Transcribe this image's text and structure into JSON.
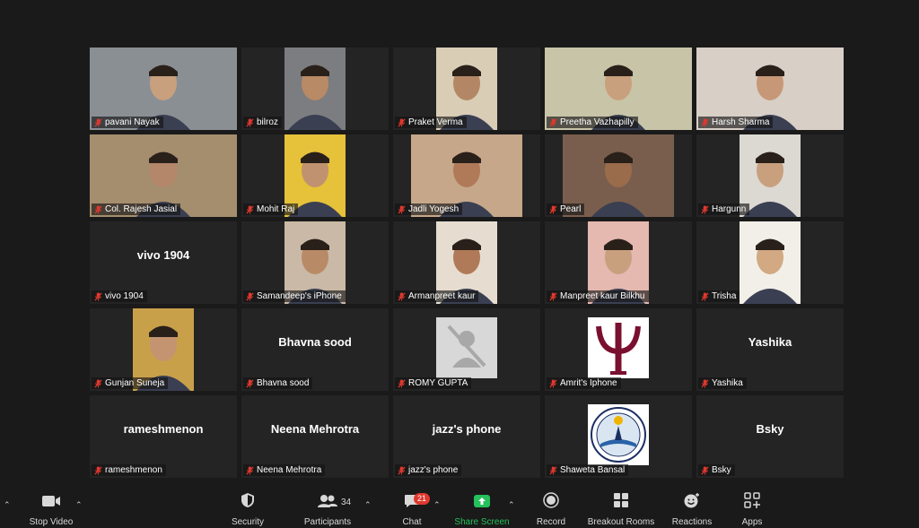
{
  "participants": [
    {
      "name": "pavani Nayak",
      "video": true,
      "bg": "#8a8f94",
      "face": "#c9a07d"
    },
    {
      "name": "bilroz",
      "video": true,
      "bg": "#7b7d80",
      "face": "#b98a66"
    },
    {
      "name": "Praket Verma",
      "video": true,
      "bg": "#d9cdb6",
      "face": "#b38765"
    },
    {
      "name": "Preetha Vazhapilly",
      "video": true,
      "bg": "#c8c4a8",
      "face": "#c9a07d"
    },
    {
      "name": "Harsh Sharma",
      "video": true,
      "bg": "#d8cfc6",
      "face": "#c79878"
    },
    {
      "name": "Col. Rajesh Jasial",
      "video": true,
      "bg": "#a58e6e",
      "face": "#b4866a"
    },
    {
      "name": "Mohit Raj",
      "video": true,
      "bg": "#e6c13a",
      "face": "#c09270"
    },
    {
      "name": "Jadli Yogesh",
      "video": true,
      "bg": "#c6a78a",
      "face": "#b07a58"
    },
    {
      "name": "Pearl",
      "video": true,
      "bg": "#7a5e4d",
      "face": "#9a6c4c"
    },
    {
      "name": "Hargunn",
      "video": true,
      "bg": "#dcd8d2",
      "face": "#c9a07d"
    },
    {
      "name": "vivo 1904",
      "video": false
    },
    {
      "name": "Samandeep's iPhone",
      "video": true,
      "bg": "#c9b9a6",
      "face": "#b98a66"
    },
    {
      "name": "Armanpreet kaur",
      "video": true,
      "bg": "#e6ddd0",
      "face": "#b07a58"
    },
    {
      "name": "Manpreet kaur Bilkhu",
      "video": true,
      "bg": "#e5b8b0",
      "face": "#c9a07d"
    },
    {
      "name": "Trisha",
      "video": true,
      "bg": "#f2efe8",
      "face": "#d2a982"
    },
    {
      "name": "Gunjan Suneja",
      "video": true,
      "bg": "#c9a04a",
      "face": "#c49370"
    },
    {
      "name": "Bhavna sood",
      "video": false
    },
    {
      "name": "ROMY GUPTA",
      "video": false,
      "placeholder": true
    },
    {
      "name": "Amrit's Iphone",
      "video": false,
      "psi": true
    },
    {
      "name": "Yashika",
      "video": false
    },
    {
      "name": "rameshmenon",
      "video": false
    },
    {
      "name": "Neena Mehrotra",
      "video": false
    },
    {
      "name": "jazz's phone",
      "video": false
    },
    {
      "name": "Shaweta Bansal",
      "video": false,
      "logo": true
    },
    {
      "name": "Bsky",
      "video": false
    }
  ],
  "toolbar": {
    "stop_video": "Stop Video",
    "security": "Security",
    "participants": "Participants",
    "participants_count": "34",
    "chat": "Chat",
    "chat_badge": "21",
    "share_screen": "Share Screen",
    "record": "Record",
    "breakout_rooms": "Breakout Rooms",
    "reactions": "Reactions",
    "apps": "Apps"
  },
  "colors": {
    "share_green": "#25c15b",
    "mic_muted": "#e0382e",
    "badge": "#e0382e"
  }
}
